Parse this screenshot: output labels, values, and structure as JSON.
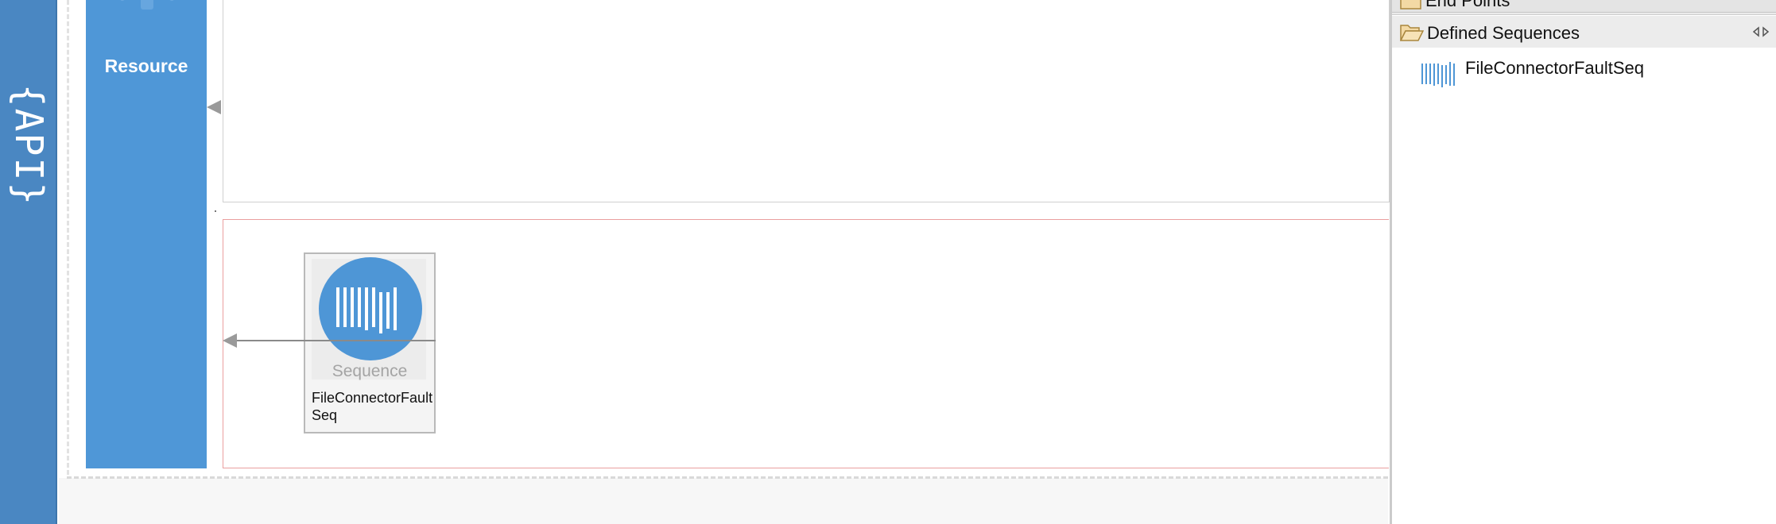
{
  "api_bar": {
    "label": "{API}"
  },
  "resource": {
    "label": "Resource"
  },
  "fault_sequence": {
    "mediator_type": "Sequence",
    "mediator_name": "FileConnectorFaultSeq"
  },
  "palette": {
    "endpoints_header": "End Points",
    "sequences_header": "Defined Sequences",
    "items": [
      {
        "label": "FileConnectorFaultSeq",
        "icon": "sequence-icon"
      }
    ]
  },
  "colors": {
    "api_bar": "#4a87c2",
    "resource": "#4f97d7",
    "fault_border": "#ea9f9f",
    "sequence_circle": "#4e96d6"
  }
}
